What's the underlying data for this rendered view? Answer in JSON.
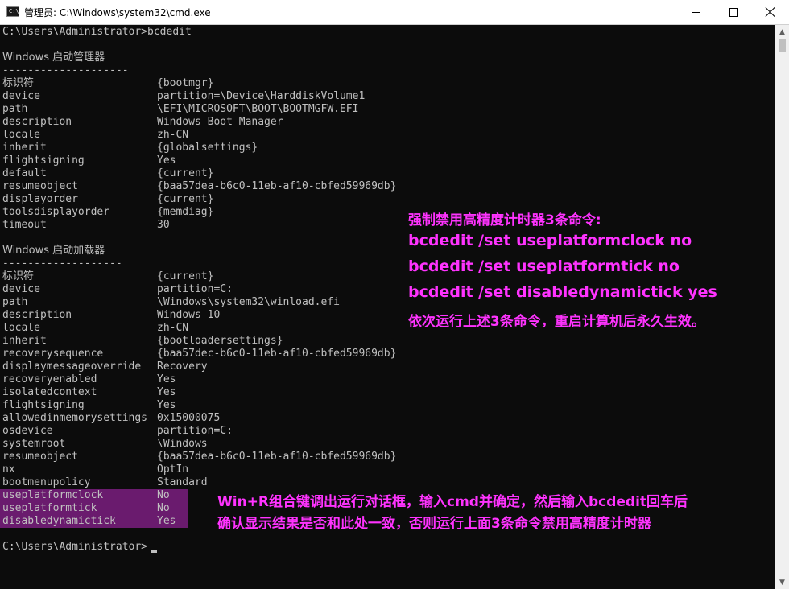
{
  "window": {
    "title": "管理员: C:\\Windows\\system32\\cmd.exe",
    "icon_label": "C:\\"
  },
  "console": {
    "command_line": "C:\\Users\\Administrator>bcdedit",
    "boot_manager": {
      "header": "Windows 启动管理器",
      "separator": "--------------------",
      "entries": [
        {
          "key": "标识符",
          "value": "{bootmgr}"
        },
        {
          "key": "device",
          "value": "partition=\\Device\\HarddiskVolume1"
        },
        {
          "key": "path",
          "value": "\\EFI\\MICROSOFT\\BOOT\\BOOTMGFW.EFI"
        },
        {
          "key": "description",
          "value": "Windows Boot Manager"
        },
        {
          "key": "locale",
          "value": "zh-CN"
        },
        {
          "key": "inherit",
          "value": "{globalsettings}"
        },
        {
          "key": "flightsigning",
          "value": "Yes"
        },
        {
          "key": "default",
          "value": "{current}"
        },
        {
          "key": "resumeobject",
          "value": "{baa57dea-b6c0-11eb-af10-cbfed59969db}"
        },
        {
          "key": "displayorder",
          "value": "{current}"
        },
        {
          "key": "toolsdisplayorder",
          "value": "{memdiag}"
        },
        {
          "key": "timeout",
          "value": "30"
        }
      ]
    },
    "boot_loader": {
      "header": "Windows 启动加载器",
      "separator": "-------------------",
      "entries": [
        {
          "key": "标识符",
          "value": "{current}"
        },
        {
          "key": "device",
          "value": "partition=C:"
        },
        {
          "key": "path",
          "value": "\\Windows\\system32\\winload.efi"
        },
        {
          "key": "description",
          "value": "Windows 10"
        },
        {
          "key": "locale",
          "value": "zh-CN"
        },
        {
          "key": "inherit",
          "value": "{bootloadersettings}"
        },
        {
          "key": "recoverysequence",
          "value": "{baa57dec-b6c0-11eb-af10-cbfed59969db}"
        },
        {
          "key": "displaymessageoverride",
          "value": "Recovery"
        },
        {
          "key": "recoveryenabled",
          "value": "Yes"
        },
        {
          "key": "isolatedcontext",
          "value": "Yes"
        },
        {
          "key": "flightsigning",
          "value": "Yes"
        },
        {
          "key": "allowedinmemorysettings",
          "value": "0x15000075"
        },
        {
          "key": "osdevice",
          "value": "partition=C:"
        },
        {
          "key": "systemroot",
          "value": "\\Windows"
        },
        {
          "key": "resumeobject",
          "value": "{baa57dea-b6c0-11eb-af10-cbfed59969db}"
        },
        {
          "key": "nx",
          "value": "OptIn"
        },
        {
          "key": "bootmenupolicy",
          "value": "Standard"
        },
        {
          "key": "useplatformclock",
          "value": "No"
        },
        {
          "key": "useplatformtick",
          "value": "No"
        },
        {
          "key": "disabledynamictick",
          "value": "Yes"
        }
      ]
    },
    "final_prompt": "C:\\Users\\Administrator>"
  },
  "annotations": {
    "top_title": "强制禁用高精度计时器3条命令:",
    "commands": [
      "bcdedit /set useplatformclock no",
      "bcdedit /set useplatformtick no",
      "bcdedit /set disabledynamictick yes"
    ],
    "top_footer": "依次运行上述3条命令，重启计算机后永久生效。",
    "bottom_line1": "Win+R组合键调出运行对话框，输入cmd并确定，然后输入bcdedit回车后",
    "bottom_line2": "确认显示结果是否和此处一致，否则运行上面3条命令禁用高精度计时器"
  },
  "colors": {
    "annotation": "#ff33ff",
    "highlight": "#6a1b6e",
    "console_bg": "#0c0c0c",
    "console_text": "#c0c0c0"
  }
}
